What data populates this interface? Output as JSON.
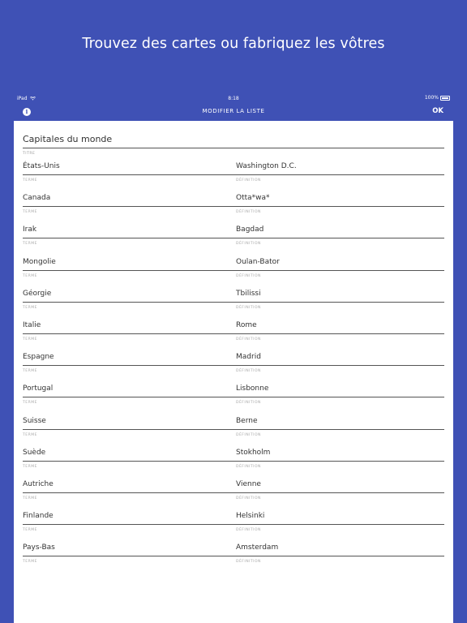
{
  "headline": "Trouvez des cartes ou fabriquez les vôtres",
  "status_bar": {
    "carrier": "iPad",
    "time": "8:18",
    "battery": "100%"
  },
  "nav": {
    "title": "MODIFIER LA LISTE",
    "ok_label": "OK",
    "info_icon": "info-icon"
  },
  "list": {
    "title": "Capitales du monde",
    "title_caption": "TITRE",
    "term_caption": "TERME",
    "definition_caption": "DÉFINITION",
    "rows": [
      {
        "term": "États-Unis",
        "definition": "Washington D.C."
      },
      {
        "term": "Canada",
        "definition": "Otta*wa*"
      },
      {
        "term": "Irak",
        "definition": "Bagdad"
      },
      {
        "term": "Mongolie",
        "definition": "Oulan-Bator"
      },
      {
        "term": "Géorgie",
        "definition": "Tbilissi"
      },
      {
        "term": "Italie",
        "definition": "Rome"
      },
      {
        "term": "Espagne",
        "definition": "Madrid"
      },
      {
        "term": "Portugal",
        "definition": "Lisbonne"
      },
      {
        "term": "Suisse",
        "definition": "Berne"
      },
      {
        "term": "Suède",
        "definition": "Stokholm"
      },
      {
        "term": "Autriche",
        "definition": "Vienne"
      },
      {
        "term": "Finlande",
        "definition": "Helsinki"
      },
      {
        "term": "Pays-Bas",
        "definition": "Amsterdam"
      }
    ]
  }
}
